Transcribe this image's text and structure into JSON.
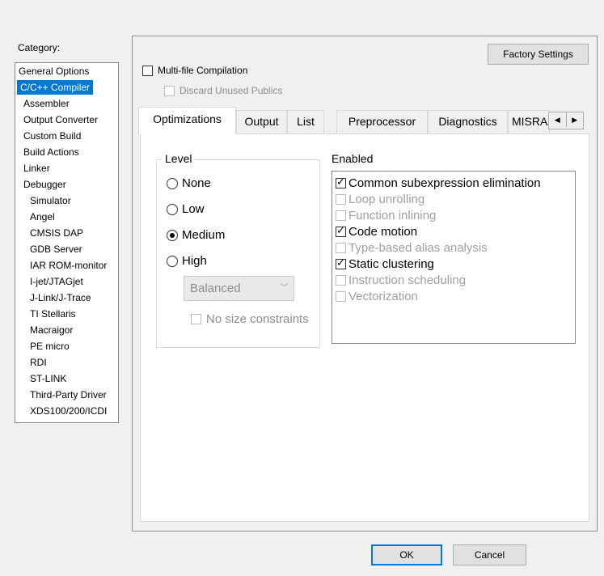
{
  "category": {
    "label": "Category:",
    "items": [
      {
        "label": "General Options",
        "sub": false
      },
      {
        "label": "C/C++ Compiler",
        "sub": true,
        "selected": true
      },
      {
        "label": "Assembler",
        "sub": true
      },
      {
        "label": "Output Converter",
        "sub": true
      },
      {
        "label": "Custom Build",
        "sub": true
      },
      {
        "label": "Build Actions",
        "sub": true
      },
      {
        "label": "Linker",
        "sub": true
      },
      {
        "label": "Debugger",
        "sub": true
      },
      {
        "label": "Simulator",
        "sub": true,
        "level": 2
      },
      {
        "label": "Angel",
        "sub": true,
        "level": 2
      },
      {
        "label": "CMSIS DAP",
        "sub": true,
        "level": 2
      },
      {
        "label": "GDB Server",
        "sub": true,
        "level": 2
      },
      {
        "label": "IAR ROM-monitor",
        "sub": true,
        "level": 2
      },
      {
        "label": "I-jet/JTAGjet",
        "sub": true,
        "level": 2
      },
      {
        "label": "J-Link/J-Trace",
        "sub": true,
        "level": 2
      },
      {
        "label": "TI Stellaris",
        "sub": true,
        "level": 2
      },
      {
        "label": "Macraigor",
        "sub": true,
        "level": 2
      },
      {
        "label": "PE micro",
        "sub": true,
        "level": 2
      },
      {
        "label": "RDI",
        "sub": true,
        "level": 2
      },
      {
        "label": "ST-LINK",
        "sub": true,
        "level": 2
      },
      {
        "label": "Third-Party Driver",
        "sub": true,
        "level": 2
      },
      {
        "label": "XDS100/200/ICDI",
        "sub": true,
        "level": 2
      }
    ]
  },
  "factory_settings": "Factory Settings",
  "multi_file": {
    "label": "Multi-file Compilation",
    "checked": false
  },
  "discard_unused": {
    "label": "Discard Unused Publics",
    "checked": false,
    "enabled": false
  },
  "tabs": [
    {
      "label": "Optimizations",
      "active": true
    },
    {
      "label": "Output"
    },
    {
      "label": "List"
    },
    {
      "label": "Preprocessor"
    },
    {
      "label": "Diagnostics"
    },
    {
      "label": "MISRA"
    }
  ],
  "tab_scroll": {
    "left": "◀",
    "right": "▶"
  },
  "level": {
    "label": "Level",
    "options": [
      {
        "label": "None",
        "checked": false
      },
      {
        "label": "Low",
        "checked": false
      },
      {
        "label": "Medium",
        "checked": true
      },
      {
        "label": "High",
        "checked": false
      }
    ],
    "high_mode": "Balanced",
    "no_size_constraints": "No size constraints"
  },
  "enabled": {
    "label": "Enabled",
    "items": [
      {
        "label": "Common subexpression elimination",
        "checked": true,
        "enabled": true
      },
      {
        "label": "Loop unrolling",
        "checked": false,
        "enabled": false
      },
      {
        "label": "Function inlining",
        "checked": false,
        "enabled": false
      },
      {
        "label": "Code motion",
        "checked": true,
        "enabled": true
      },
      {
        "label": "Type-based alias analysis",
        "checked": false,
        "enabled": false
      },
      {
        "label": "Static clustering",
        "checked": true,
        "enabled": true
      },
      {
        "label": "Instruction scheduling",
        "checked": false,
        "enabled": false
      },
      {
        "label": "Vectorization",
        "checked": false,
        "enabled": false
      }
    ]
  },
  "ok": "OK",
  "cancel": "Cancel"
}
